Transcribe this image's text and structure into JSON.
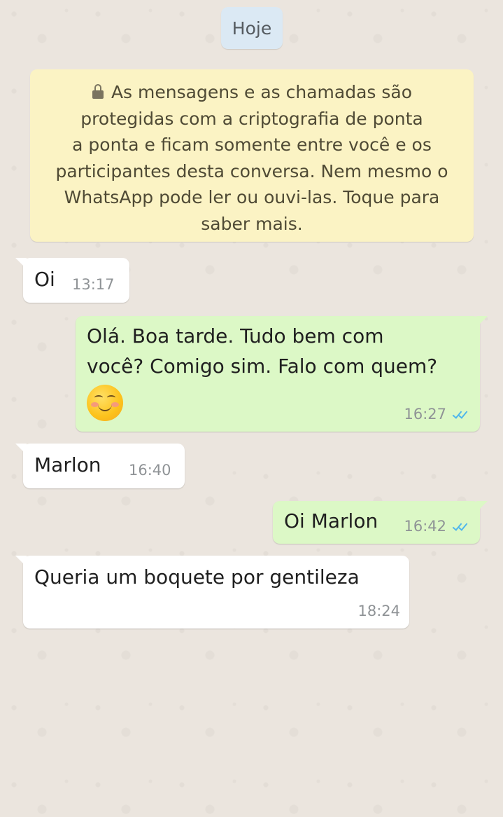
{
  "date_chip": "Hoje",
  "encryption_notice": {
    "lines": [
      "As mensagens e as chamadas são",
      "protegidas com a criptografia de ponta",
      "a ponta e ficam somente entre você e os",
      "participantes desta conversa. Nem mesmo o",
      "WhatsApp pode ler ou ouvi-las. Toque para",
      "saber mais."
    ]
  },
  "messages": [
    {
      "direction": "incoming",
      "lines": [
        "Oi"
      ],
      "time": "13:17"
    },
    {
      "direction": "outgoing",
      "lines": [
        "Olá. Boa tarde. Tudo bem com",
        "você? Comigo sim. Falo com quem?"
      ],
      "emoji": "smiling-face-with-smiling-eyes",
      "time": "16:27",
      "status": "read"
    },
    {
      "direction": "incoming",
      "lines": [
        "Marlon"
      ],
      "time": "16:40"
    },
    {
      "direction": "outgoing",
      "lines": [
        "Oi Marlon"
      ],
      "time": "16:42",
      "status": "read"
    },
    {
      "direction": "incoming",
      "lines": [
        "Queria um boquete por gentileza"
      ],
      "time": "18:24"
    }
  ],
  "colors": {
    "incoming_bubble": "#ffffff",
    "outgoing_bubble": "#dcf8c6",
    "notice_background": "#fbf3c4",
    "date_chip_background": "#dbe9f4",
    "read_ticks": "#4fb6ec",
    "wallpaper": "#ebe5de"
  }
}
